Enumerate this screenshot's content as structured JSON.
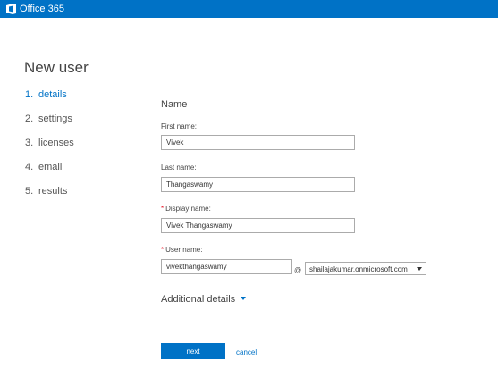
{
  "header": {
    "brand": "Office 365",
    "accent": "#0072c6"
  },
  "page": {
    "title": "New user"
  },
  "steps": [
    {
      "num": "1.",
      "label": "details",
      "active": true
    },
    {
      "num": "2.",
      "label": "settings",
      "active": false
    },
    {
      "num": "3.",
      "label": "licenses",
      "active": false
    },
    {
      "num": "4.",
      "label": "email",
      "active": false
    },
    {
      "num": "5.",
      "label": "results",
      "active": false
    }
  ],
  "form": {
    "section": "Name",
    "first_name": {
      "label": "First name:",
      "value": "Vivek"
    },
    "last_name": {
      "label": "Last name:",
      "value": "Thangaswamy"
    },
    "display_name": {
      "required": "*",
      "label": "Display name:",
      "value": "Vivek Thangaswamy"
    },
    "user_name": {
      "required": "*",
      "label": "User name:",
      "value": "vivekthangaswamy"
    },
    "at": "@",
    "domain": {
      "selected": "shailajakumar.onmicrosoft.com"
    },
    "additional_details": "Additional details"
  },
  "actions": {
    "next": "next",
    "cancel": "cancel"
  }
}
